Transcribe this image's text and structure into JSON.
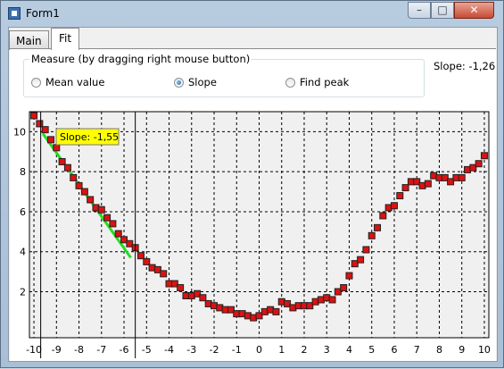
{
  "window": {
    "title": "Form1",
    "min_glyph": "–",
    "max_glyph": "□",
    "close_glyph": "✕"
  },
  "tabs": [
    {
      "label": "Main"
    },
    {
      "label": "Fit"
    }
  ],
  "measure": {
    "legend": "Measure (by dragging right mouse button)",
    "options": [
      {
        "label": "Mean value",
        "selected": false
      },
      {
        "label": "Slope",
        "selected": true
      },
      {
        "label": "Find peak",
        "selected": false
      }
    ]
  },
  "slope_readout": "Slope: -1,26",
  "chart_data": {
    "type": "scatter",
    "xlim": [
      -10.2,
      10.2
    ],
    "ylim": [
      -0.3,
      11.0
    ],
    "x_ticks": [
      "-10",
      "-9",
      "-8",
      "-7",
      "-6",
      "-5",
      "-4",
      "-3",
      "-2",
      "-1",
      "0",
      "1",
      "2",
      "3",
      "4",
      "5",
      "6",
      "7",
      "8",
      "9",
      "10"
    ],
    "y_ticks": [
      "2",
      "4",
      "6",
      "8",
      "10"
    ],
    "grid": true,
    "marker_color": "#dd1111",
    "fit_line_color": "#22dd22",
    "fit_line": {
      "x": [
        -9.6,
        -5.7
      ],
      "y": [
        9.9,
        3.7
      ]
    },
    "cursor_lines_x": [
      -9.7,
      -5.5
    ],
    "annotation": "Slope: -1,55",
    "points": [
      [
        -10.0,
        10.8
      ],
      [
        -9.75,
        10.4
      ],
      [
        -9.5,
        10.1
      ],
      [
        -9.25,
        9.6
      ],
      [
        -9.0,
        9.2
      ],
      [
        -8.75,
        8.5
      ],
      [
        -8.5,
        8.2
      ],
      [
        -8.25,
        7.7
      ],
      [
        -8.0,
        7.3
      ],
      [
        -7.75,
        7.0
      ],
      [
        -7.5,
        6.6
      ],
      [
        -7.25,
        6.2
      ],
      [
        -7.0,
        6.1
      ],
      [
        -6.75,
        5.7
      ],
      [
        -6.5,
        5.4
      ],
      [
        -6.25,
        4.9
      ],
      [
        -6.0,
        4.6
      ],
      [
        -5.75,
        4.4
      ],
      [
        -5.5,
        4.2
      ],
      [
        -5.25,
        3.8
      ],
      [
        -5.0,
        3.5
      ],
      [
        -4.75,
        3.2
      ],
      [
        -4.5,
        3.1
      ],
      [
        -4.25,
        2.9
      ],
      [
        -4.0,
        2.4
      ],
      [
        -3.75,
        2.4
      ],
      [
        -3.5,
        2.2
      ],
      [
        -3.25,
        1.8
      ],
      [
        -3.0,
        1.8
      ],
      [
        -2.75,
        1.9
      ],
      [
        -2.5,
        1.7
      ],
      [
        -2.25,
        1.4
      ],
      [
        -2.0,
        1.3
      ],
      [
        -1.75,
        1.2
      ],
      [
        -1.5,
        1.1
      ],
      [
        -1.25,
        1.1
      ],
      [
        -1.0,
        0.9
      ],
      [
        -0.75,
        0.9
      ],
      [
        -0.5,
        0.8
      ],
      [
        -0.25,
        0.7
      ],
      [
        0.0,
        0.8
      ],
      [
        0.25,
        1.0
      ],
      [
        0.5,
        1.1
      ],
      [
        0.75,
        1.0
      ],
      [
        1.0,
        1.5
      ],
      [
        1.25,
        1.4
      ],
      [
        1.5,
        1.2
      ],
      [
        1.75,
        1.3
      ],
      [
        2.0,
        1.3
      ],
      [
        2.25,
        1.3
      ],
      [
        2.5,
        1.5
      ],
      [
        2.75,
        1.6
      ],
      [
        3.0,
        1.7
      ],
      [
        3.25,
        1.6
      ],
      [
        3.5,
        2.0
      ],
      [
        3.75,
        2.2
      ],
      [
        4.0,
        2.8
      ],
      [
        4.25,
        3.4
      ],
      [
        4.5,
        3.6
      ],
      [
        4.75,
        4.1
      ],
      [
        5.0,
        4.8
      ],
      [
        5.25,
        5.2
      ],
      [
        5.5,
        5.8
      ],
      [
        5.75,
        6.2
      ],
      [
        6.0,
        6.3
      ],
      [
        6.25,
        6.8
      ],
      [
        6.5,
        7.2
      ],
      [
        6.75,
        7.5
      ],
      [
        7.0,
        7.5
      ],
      [
        7.25,
        7.3
      ],
      [
        7.5,
        7.4
      ],
      [
        7.75,
        7.8
      ],
      [
        8.0,
        7.7
      ],
      [
        8.25,
        7.7
      ],
      [
        8.5,
        7.5
      ],
      [
        8.75,
        7.7
      ],
      [
        9.0,
        7.7
      ],
      [
        9.25,
        8.1
      ],
      [
        9.5,
        8.2
      ],
      [
        9.75,
        8.4
      ],
      [
        10.0,
        8.8
      ]
    ]
  }
}
